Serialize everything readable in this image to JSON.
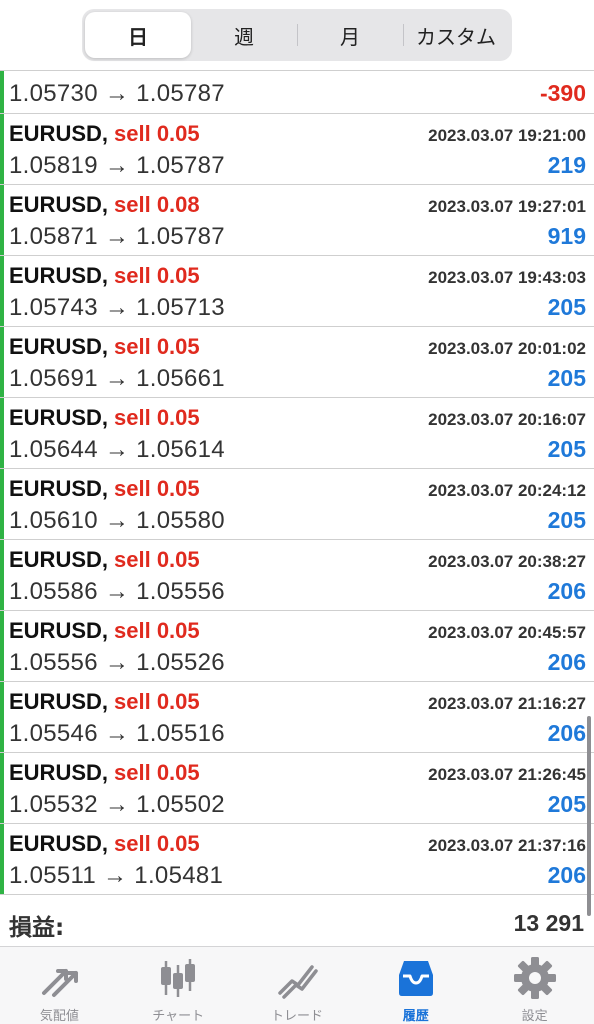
{
  "period_tabs": [
    {
      "label": "日",
      "active": true
    },
    {
      "label": "週",
      "active": false
    },
    {
      "label": "月",
      "active": false
    },
    {
      "label": "カスタム",
      "active": false
    }
  ],
  "partial_row": {
    "prices": "1.05730 → 1.05787",
    "profit": "-390"
  },
  "trades": [
    {
      "symbol": "EURUSD,",
      "side": "sell 0.05",
      "time": "2023.03.07 19:21:00",
      "prices": "1.05819 → 1.05787",
      "profit": "219"
    },
    {
      "symbol": "EURUSD,",
      "side": "sell 0.08",
      "time": "2023.03.07 19:27:01",
      "prices": "1.05871 → 1.05787",
      "profit": "919"
    },
    {
      "symbol": "EURUSD,",
      "side": "sell 0.05",
      "time": "2023.03.07 19:43:03",
      "prices": "1.05743 → 1.05713",
      "profit": "205"
    },
    {
      "symbol": "EURUSD,",
      "side": "sell 0.05",
      "time": "2023.03.07 20:01:02",
      "prices": "1.05691 → 1.05661",
      "profit": "205"
    },
    {
      "symbol": "EURUSD,",
      "side": "sell 0.05",
      "time": "2023.03.07 20:16:07",
      "prices": "1.05644 → 1.05614",
      "profit": "205"
    },
    {
      "symbol": "EURUSD,",
      "side": "sell 0.05",
      "time": "2023.03.07 20:24:12",
      "prices": "1.05610 → 1.05580",
      "profit": "205"
    },
    {
      "symbol": "EURUSD,",
      "side": "sell 0.05",
      "time": "2023.03.07 20:38:27",
      "prices": "1.05586 → 1.05556",
      "profit": "206"
    },
    {
      "symbol": "EURUSD,",
      "side": "sell 0.05",
      "time": "2023.03.07 20:45:57",
      "prices": "1.05556 → 1.05526",
      "profit": "206"
    },
    {
      "symbol": "EURUSD,",
      "side": "sell 0.05",
      "time": "2023.03.07 21:16:27",
      "prices": "1.05546 → 1.05516",
      "profit": "206"
    },
    {
      "symbol": "EURUSD,",
      "side": "sell 0.05",
      "time": "2023.03.07 21:26:45",
      "prices": "1.05532 → 1.05502",
      "profit": "205"
    },
    {
      "symbol": "EURUSD,",
      "side": "sell 0.05",
      "time": "2023.03.07 21:37:16",
      "prices": "1.05511 → 1.05481",
      "profit": "206"
    }
  ],
  "summary": {
    "label": "損益:",
    "value": "13 291"
  },
  "tabbar": [
    {
      "label": "気配値",
      "icon": "quotes-icon",
      "active": false
    },
    {
      "label": "チャート",
      "icon": "chart-icon",
      "active": false
    },
    {
      "label": "トレード",
      "icon": "trade-icon",
      "active": false
    },
    {
      "label": "履歴",
      "icon": "history-icon",
      "active": true
    },
    {
      "label": "設定",
      "icon": "settings-icon",
      "active": false
    }
  ],
  "colors": {
    "sell": "#e02a1e",
    "profit_positive": "#1f79d9",
    "profit_negative": "#e02a1e",
    "accent": "#1a73d9",
    "position_marker": "#2fb344"
  }
}
